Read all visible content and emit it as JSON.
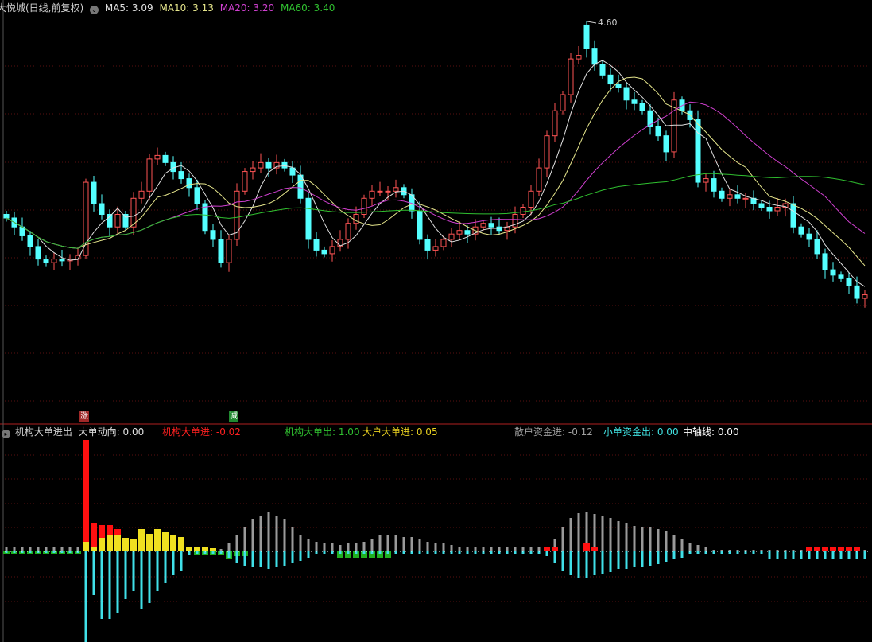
{
  "header": {
    "title": "大悦城(日线,前复权)",
    "ma_labels": [
      {
        "label": "MA5: 3.09",
        "color": "#e0e0e0"
      },
      {
        "label": "MA10: 3.13",
        "color": "#e6e68c"
      },
      {
        "label": "MA20: 3.20",
        "color": "#d040d0"
      },
      {
        "label": "MA60: 3.40",
        "color": "#30c030"
      }
    ]
  },
  "indicator": {
    "name": "机构大单进出",
    "items": [
      {
        "label": "大单动向: 0.00",
        "color": "#e0e0e0"
      },
      {
        "label": "机构大单进: -0.02",
        "color": "#ff2020"
      },
      {
        "label": "机构大单出: 1.00",
        "color": "#30c030"
      },
      {
        "label": "大户大单进: 0.05",
        "color": "#e8d020"
      },
      {
        "label": "散户资金进: -0.12",
        "color": "#a0a0a0"
      },
      {
        "label": "小单资金出: 0.00",
        "color": "#40e0e0"
      },
      {
        "label": "中轴线: 0.00",
        "color": "#ffffff"
      }
    ],
    "markers": [
      {
        "text": "涨",
        "color": "#a02828"
      },
      {
        "text": "减",
        "color": "#208a30"
      }
    ]
  },
  "chart_data": [
    {
      "type": "candlestick",
      "title": "大悦城(日线,前复权)",
      "ylim": [
        2.36,
        4.72
      ],
      "high_label": "4.60",
      "high_point": {
        "index": 73,
        "value": 4.6
      },
      "open_overrides": {
        "73": 4.58,
        "10": 3.29
      },
      "closes": [
        3.5,
        3.45,
        3.4,
        3.34,
        3.27,
        3.25,
        3.27,
        3.26,
        3.27,
        3.29,
        3.7,
        3.58,
        3.52,
        3.45,
        3.52,
        3.45,
        3.61,
        3.65,
        3.83,
        3.85,
        3.81,
        3.76,
        3.72,
        3.67,
        3.58,
        3.43,
        3.38,
        3.25,
        3.38,
        3.65,
        3.76,
        3.78,
        3.81,
        3.78,
        3.81,
        3.78,
        3.74,
        3.61,
        3.38,
        3.32,
        3.3,
        3.34,
        3.38,
        3.47,
        3.52,
        3.61,
        3.65,
        3.65,
        3.65,
        3.67,
        3.63,
        3.54,
        3.38,
        3.32,
        3.34,
        3.38,
        3.41,
        3.43,
        3.41,
        3.45,
        3.47,
        3.45,
        3.43,
        3.45,
        3.52,
        3.56,
        3.65,
        3.78,
        3.96,
        4.1,
        4.19,
        4.39,
        4.41,
        4.45,
        4.36,
        4.3,
        4.25,
        4.23,
        4.16,
        4.14,
        4.1,
        4.01,
        3.96,
        3.87,
        4.16,
        4.1,
        4.05,
        3.7,
        3.72,
        3.65,
        3.61,
        3.63,
        3.61,
        3.61,
        3.58,
        3.56,
        3.54,
        3.56,
        3.58,
        3.45,
        3.41,
        3.38,
        3.3,
        3.21,
        3.18,
        3.16,
        3.12,
        3.05,
        3.07
      ],
      "ma_periods": [
        5,
        10,
        20,
        60
      ],
      "ma_colors": [
        "#e0e0e0",
        "#e6e68c",
        "#d040d0",
        "#30c030"
      ],
      "up_color": "#ff5454",
      "down_color": "#54ffff"
    },
    {
      "type": "bar",
      "title": "机构大单进出",
      "ylim": [
        -1.14,
        1.4
      ],
      "series": [
        {
          "name": "散户资金进",
          "color": "#9a9a9a",
          "direction": "up",
          "values": [
            0.05,
            0.05,
            0.05,
            0.05,
            0.05,
            0.05,
            0.05,
            0.05,
            0.05,
            0.05,
            0.03,
            0.03,
            0.03,
            0.03,
            0.03,
            0.03,
            0.03,
            0.03,
            0.03,
            0.03,
            0.03,
            0.03,
            0.03,
            0.03,
            0.03,
            0.03,
            0.03,
            0.03,
            0.1,
            0.2,
            0.3,
            0.4,
            0.45,
            0.5,
            0.45,
            0.4,
            0.3,
            0.2,
            0.15,
            0.12,
            0.1,
            0.1,
            0.08,
            0.1,
            0.1,
            0.12,
            0.15,
            0.2,
            0.2,
            0.2,
            0.18,
            0.18,
            0.15,
            0.12,
            0.1,
            0.1,
            0.08,
            0.06,
            0.06,
            0.06,
            0.06,
            0.06,
            0.06,
            0.06,
            0.06,
            0.06,
            0.06,
            0.06,
            0.03,
            0.15,
            0.3,
            0.42,
            0.48,
            0.5,
            0.47,
            0.45,
            0.42,
            0.38,
            0.35,
            0.32,
            0.3,
            0.3,
            0.28,
            0.25,
            0.2,
            0.15,
            0.1,
            0.08,
            0.05,
            0.02,
            0.02,
            0.02,
            0.02,
            0.02,
            0.02,
            0.02,
            0.02,
            0.02,
            0.02,
            0.02,
            0.02,
            0.02,
            0.02,
            0.02,
            0.02,
            0.02,
            0.02,
            0.02,
            0.02
          ]
        },
        {
          "name": "小单资金出",
          "color": "#40e0e8",
          "direction": "down",
          "values": [
            0.02,
            0.02,
            0.02,
            0.02,
            0.02,
            0.02,
            0.02,
            0.02,
            0.02,
            0.02,
            1.14,
            0.55,
            0.85,
            0.85,
            0.78,
            0.6,
            0.5,
            0.72,
            0.65,
            0.5,
            0.4,
            0.3,
            0.25,
            0.05,
            0.03,
            0.03,
            0.03,
            0.03,
            0.08,
            0.15,
            0.18,
            0.2,
            0.2,
            0.22,
            0.2,
            0.18,
            0.15,
            0.12,
            0.08,
            0.04,
            0.04,
            0.04,
            0.04,
            0.04,
            0.04,
            0.04,
            0.04,
            0.04,
            0.04,
            0.04,
            0.04,
            0.04,
            0.04,
            0.04,
            0.04,
            0.04,
            0.04,
            0.04,
            0.04,
            0.04,
            0.04,
            0.04,
            0.04,
            0.04,
            0.04,
            0.04,
            0.04,
            0.04,
            0.06,
            0.15,
            0.25,
            0.3,
            0.33,
            0.33,
            0.3,
            0.28,
            0.26,
            0.22,
            0.22,
            0.2,
            0.2,
            0.18,
            0.16,
            0.14,
            0.1,
            0.08,
            0.03,
            0.03,
            0.03,
            0.03,
            0.03,
            0.03,
            0.03,
            0.03,
            0.03,
            0.03,
            0.1,
            0.1,
            0.1,
            0.1,
            0.1,
            0.1,
            0.1,
            0.1,
            0.1,
            0.1,
            0.1,
            0.1,
            0.1
          ]
        },
        {
          "name": "大户大单进",
          "color": "#f0e020",
          "direction": "up",
          "values": [
            0,
            0,
            0,
            0,
            0,
            0,
            0,
            0,
            0,
            0,
            0.12,
            0.05,
            0.17,
            0.2,
            0.2,
            0.17,
            0.15,
            0.28,
            0.22,
            0.28,
            0.24,
            0.2,
            0.18,
            0.06,
            0.05,
            0.05,
            0.04
          ]
        },
        {
          "name": "机构大单进",
          "color": "#ff1010",
          "direction": "up",
          "stacked_on": "大户大单进",
          "values": [
            0,
            0,
            0,
            0,
            0,
            0,
            0,
            0,
            0,
            0,
            1.28,
            0.3,
            0.16,
            0.13,
            0.08,
            0,
            0,
            0,
            0,
            0,
            0,
            0,
            0,
            0,
            0,
            0,
            0,
            0,
            0,
            0,
            0,
            0,
            0,
            0,
            0,
            0,
            0,
            0,
            0,
            0,
            0,
            0,
            0,
            0,
            0,
            0,
            0,
            0,
            0,
            0,
            0,
            0,
            0,
            0,
            0,
            0,
            0,
            0,
            0,
            0,
            0,
            0,
            0,
            0,
            0,
            0,
            0,
            0,
            0.05,
            0.05,
            0,
            0,
            0,
            0.1,
            0.06,
            0,
            0,
            0,
            0,
            0,
            0,
            0,
            0,
            0,
            0,
            0,
            0,
            0,
            0,
            0,
            0,
            0,
            0,
            0,
            0,
            0,
            0,
            0,
            0,
            0,
            0,
            0.05,
            0.05,
            0.05,
            0.05,
            0.05,
            0.05,
            0.05
          ]
        },
        {
          "name": "机构大单出",
          "color": "#20b020",
          "direction": "down",
          "values": [
            0.04,
            0.04,
            0.04,
            0.04,
            0.04,
            0.04,
            0.04,
            0.04,
            0.04,
            0.04,
            0,
            0,
            0,
            0,
            0,
            0,
            0,
            0,
            0,
            0,
            0,
            0,
            0,
            0,
            0.05,
            0.05,
            0.05,
            0.05,
            0.1,
            0.06,
            0.06,
            0,
            0,
            0,
            0,
            0,
            0,
            0,
            0,
            0,
            0,
            0,
            0.08,
            0.08,
            0.08,
            0.08,
            0.08,
            0.08,
            0.08
          ]
        }
      ]
    }
  ]
}
